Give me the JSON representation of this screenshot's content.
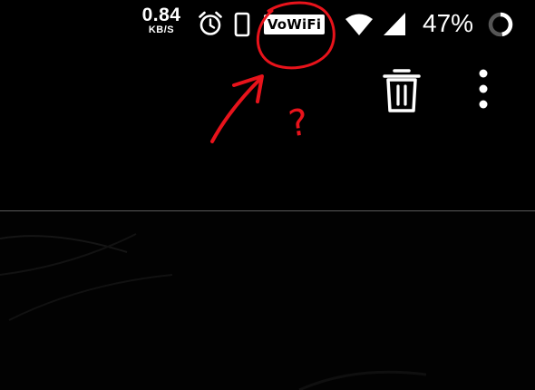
{
  "status_bar": {
    "net_speed_value": "0.84",
    "net_speed_unit": "KB/S",
    "vowifi_label": "VoWiFi",
    "battery_percent": "47%",
    "battery_level": 0.47,
    "icons": [
      "alarm-icon",
      "vibrate-icon",
      "vowifi-badge",
      "wifi-icon",
      "cell-signal-icon",
      "battery-ring-icon"
    ]
  },
  "annotation": {
    "mark": "?",
    "color": "#e8131b"
  },
  "toolbar": {
    "icons": [
      "trash-icon",
      "more-vert-icon"
    ]
  },
  "colors": {
    "background": "#000000",
    "foreground": "#ffffff",
    "divider": "#5a5a5a"
  }
}
